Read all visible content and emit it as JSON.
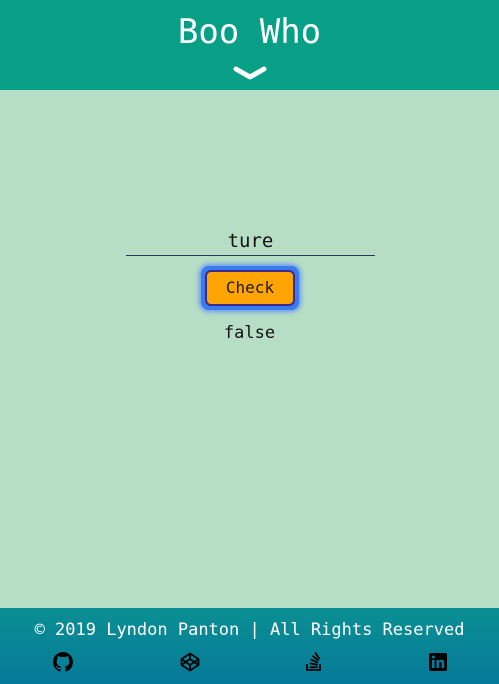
{
  "header": {
    "title": "Boo Who",
    "toggle_icon": "chevron-down-icon"
  },
  "main": {
    "input": {
      "value": "ture",
      "placeholder": ""
    },
    "check_label": "Check",
    "result": "false"
  },
  "footer": {
    "copyright": "© 2019 Lyndon Panton | All Rights Reserved",
    "links": [
      {
        "icon": "github-icon"
      },
      {
        "icon": "codepen-icon"
      },
      {
        "icon": "stackoverflow-icon"
      },
      {
        "icon": "linkedin-icon"
      }
    ]
  },
  "colors": {
    "header_bg": "#079f86",
    "page_bg": "#b6dec4",
    "button_bg": "#ffa400",
    "footer_bg": "#067a9a"
  }
}
